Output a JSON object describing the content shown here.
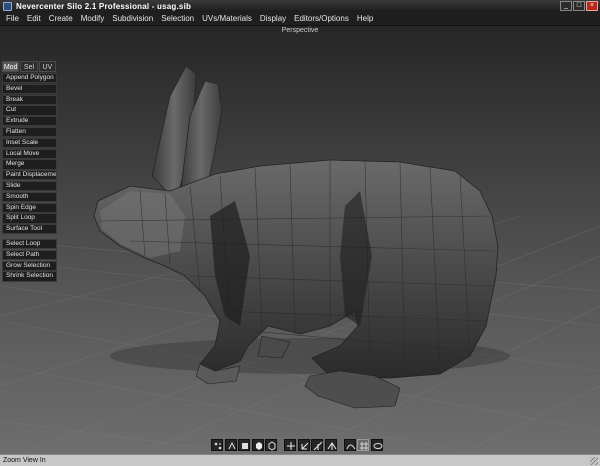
{
  "window": {
    "title": "Nevercenter Silo 2.1 Professional - usag.sib",
    "minimize": "_",
    "maximize": "□",
    "close": "×"
  },
  "menu": [
    "File",
    "Edit",
    "Create",
    "Modify",
    "Subdivision",
    "Selection",
    "UVs/Materials",
    "Display",
    "Editors/Options",
    "Help"
  ],
  "viewport": {
    "label": "Perspective"
  },
  "panel": {
    "tabs": [
      "Mod",
      "Sel",
      "UV"
    ],
    "active_tab": "Mod",
    "tools": [
      "Append Polygon",
      "Bevel",
      "Break",
      "Cut",
      "Extrude",
      "Flatten",
      "Inset Scale",
      "Local Move",
      "Merge",
      "Paint Displacement",
      "Slide",
      "Smooth",
      "Spin Edge",
      "Split Loop",
      "Surface Tool"
    ],
    "selection_tools": [
      "Select Loop",
      "Select Path",
      "Grow Selection",
      "Shrink Selection"
    ]
  },
  "toolbar_icons": [
    "vertex-mode-icon",
    "edge-mode-icon",
    "face-mode-icon",
    "object-mode-icon",
    "material-mode-icon",
    "move-manipulator-icon",
    "rotate-manipulator-icon",
    "scale-manipulator-icon",
    "universal-manipulator-icon",
    "curve-icon",
    "grid-icon",
    "subdivision-icon"
  ],
  "status": {
    "text": "Zoom View In"
  },
  "colors": {
    "viewport_top": "#262626",
    "viewport_bottom": "#6e6e6e",
    "panel_button": "#1e1e1e",
    "active_tab": "#5a5a5a"
  }
}
